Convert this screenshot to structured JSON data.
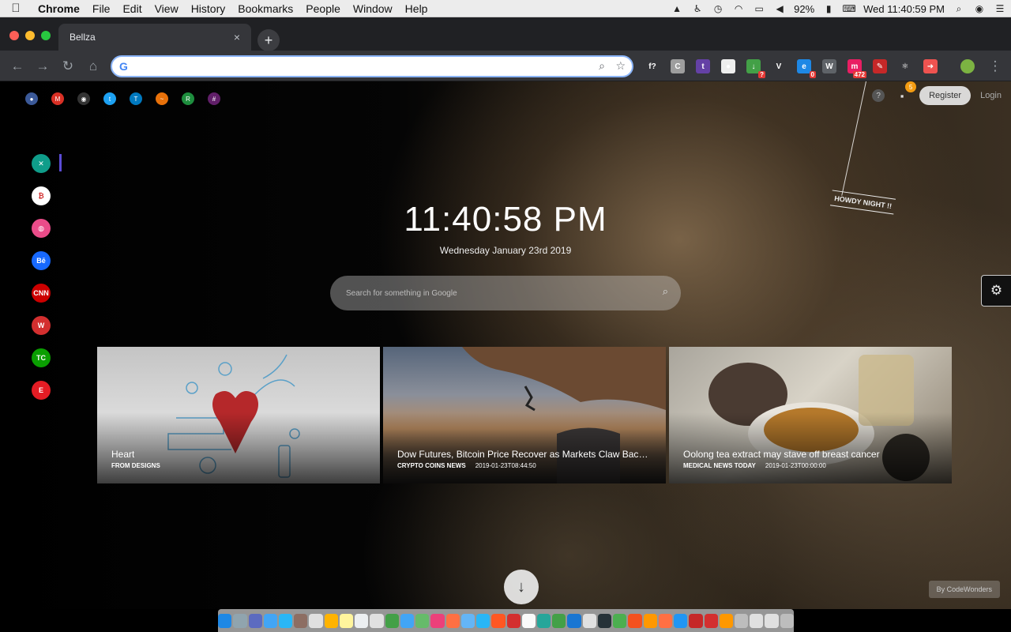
{
  "menubar": {
    "app": "Chrome",
    "items": [
      "File",
      "Edit",
      "View",
      "History",
      "Bookmarks",
      "People",
      "Window",
      "Help"
    ],
    "battery": "92%",
    "clock": "Wed 11:40:59 PM"
  },
  "tab": {
    "title": "Bellza",
    "close": "×"
  },
  "newtab_label": "+",
  "omnibox": {
    "value": "",
    "placeholder": ""
  },
  "extensions": [
    {
      "name": "fx-extension-icon",
      "glyph": "f?",
      "color": "#35363a"
    },
    {
      "name": "c-extension-icon",
      "glyph": "C",
      "color": "#9e9e9e"
    },
    {
      "name": "twitch-extension-icon",
      "glyph": "t",
      "color": "#6441a5"
    },
    {
      "name": "circle-extension-icon",
      "glyph": "●",
      "color": "#eeeeee"
    },
    {
      "name": "download-extension-icon",
      "glyph": "↓",
      "color": "#43a047",
      "badge": "?"
    },
    {
      "name": "vue-extension-icon",
      "glyph": "V",
      "color": "#35363a"
    },
    {
      "name": "app-extension-icon",
      "glyph": "e",
      "color": "#1e88e5",
      "badge": "0"
    },
    {
      "name": "wappalyzer-extension-icon",
      "glyph": "W",
      "color": "#5f6368"
    },
    {
      "name": "counter-extension-icon",
      "glyph": "m",
      "color": "#e91e63",
      "badge": "472"
    },
    {
      "name": "pin-extension-icon",
      "glyph": "✎",
      "color": "#c62828"
    },
    {
      "name": "react-extension-icon",
      "glyph": "⚛",
      "color": "#35363a"
    },
    {
      "name": "arrow-extension-icon",
      "glyph": "➜",
      "color": "#ef5350"
    }
  ],
  "quicklinks": [
    {
      "name": "quicklink-1",
      "color": "#3b5998",
      "glyph": "●"
    },
    {
      "name": "gmail-link",
      "color": "#d93025",
      "glyph": "M"
    },
    {
      "name": "github-link",
      "color": "#333333",
      "glyph": "◉"
    },
    {
      "name": "twitter-link",
      "color": "#1da1f2",
      "glyph": "t"
    },
    {
      "name": "trello-link",
      "color": "#0079bf",
      "glyph": "T"
    },
    {
      "name": "analytics-link",
      "color": "#e8710a",
      "glyph": "~"
    },
    {
      "name": "quicklink-7",
      "color": "#1e8e3e",
      "glyph": "R"
    },
    {
      "name": "slack-link",
      "color": "#611f69",
      "glyph": "#"
    }
  ],
  "topright": {
    "help": "?",
    "notif_count": "5",
    "register": "Register",
    "login": "Login"
  },
  "sidebar": [
    {
      "name": "sidebar-item-bellza",
      "color": "#0f9d8a",
      "glyph": "✕"
    },
    {
      "name": "sidebar-item-bitcoin",
      "color": "#ffffff",
      "glyph": "₿"
    },
    {
      "name": "sidebar-item-dribbble",
      "color": "#ea4c89",
      "glyph": "◍"
    },
    {
      "name": "sidebar-item-behance",
      "color": "#1769ff",
      "glyph": "Bē"
    },
    {
      "name": "sidebar-item-cnn",
      "color": "#cc0000",
      "glyph": "CNN"
    },
    {
      "name": "sidebar-item-w",
      "color": "#d32f2f",
      "glyph": "W"
    },
    {
      "name": "sidebar-item-techcrunch",
      "color": "#0a9e01",
      "glyph": "TC"
    },
    {
      "name": "sidebar-item-engadget",
      "color": "#e41c24",
      "glyph": "E"
    }
  ],
  "howdy": "HOWDY NIGHT !!",
  "time": "11:40:58 PM",
  "date": "Wednesday January 23rd 2019",
  "search": {
    "placeholder": "Search for something in Google"
  },
  "cards": [
    {
      "title": "Heart",
      "source": "FROM DESIGNS",
      "timestamp": ""
    },
    {
      "title": "Dow Futures, Bitcoin Price Recover as Markets Claw Back Ea...",
      "source": "CRYPTO COINS NEWS",
      "timestamp": "2019-01-23T08:44:50"
    },
    {
      "title": "Oolong tea extract may stave off breast cancer",
      "source": "MEDICAL NEWS TODAY",
      "timestamp": "2019-01-23T00:00:00"
    }
  ],
  "credit": "By CodeWonders",
  "dock_colors": [
    "#1e88e5",
    "#90a4ae",
    "#5c6bc0",
    "#42a5f5",
    "#29b6f6",
    "#8d6e63",
    "#e0e0e0",
    "#ffb300",
    "#fff59d",
    "#eceff1",
    "#e0e0e0",
    "#43a047",
    "#42a5f5",
    "#66bb6a",
    "#ec407a",
    "#ff7043",
    "#64b5f6",
    "#29b6f6",
    "#ff5722",
    "#d32f2f",
    "#fafafa",
    "#26a69a",
    "#43a047",
    "#1976d2",
    "#e0e0e0",
    "#263238",
    "#4caf50",
    "#f4511e",
    "#ff9800",
    "#ff7043",
    "#2196f3",
    "#c62828",
    "#d32f2f",
    "#ff9800",
    "#bdbdbd",
    "#e0e0e0",
    "#e0e0e0",
    "#bdbdbd"
  ]
}
